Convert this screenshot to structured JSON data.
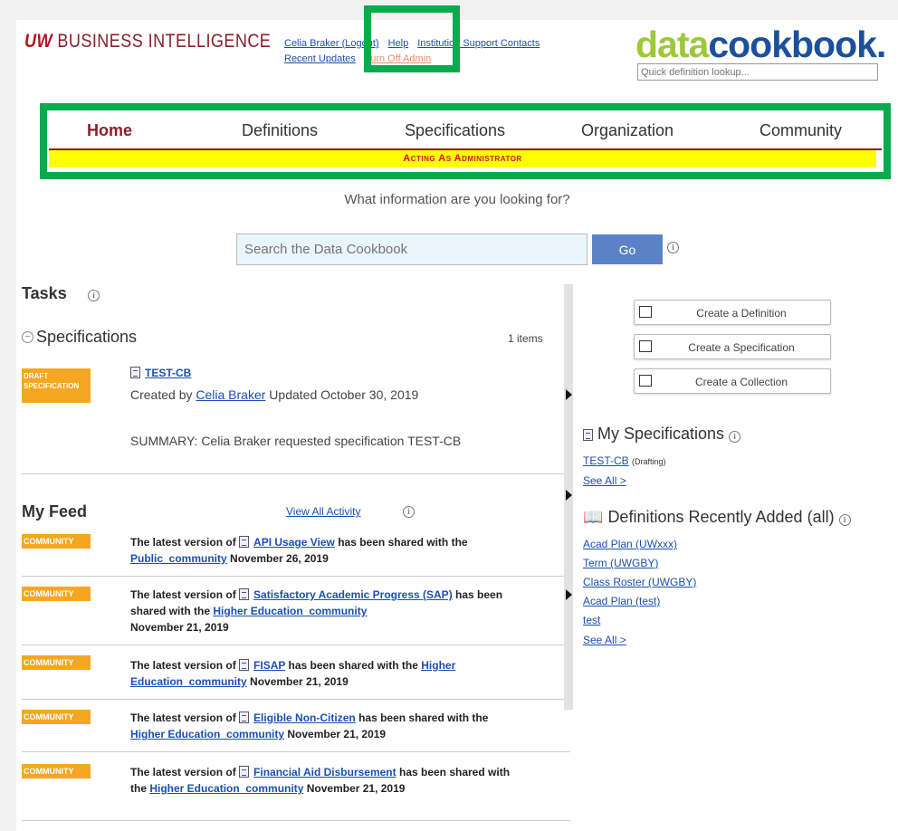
{
  "header": {
    "brand_uw": "UW",
    "brand_rest": "BUSINESS INTELLIGENCE",
    "user_link": "Celia Braker (Logout)",
    "help_link": "Help",
    "contacts_link": "Institution Support Contacts",
    "recent_updates": "Recent Updates",
    "turn_off_admin": "Turn Off Admin",
    "logo_data": "data",
    "logo_cookbook": "cookbook.",
    "quick_placeholder": "Quick definition lookup..."
  },
  "nav": {
    "items": [
      "Home",
      "Definitions",
      "Specifications",
      "Organization",
      "Community"
    ],
    "active": "Home",
    "admin_banner": "Acting As Administrator"
  },
  "search": {
    "question": "What information are you looking for?",
    "placeholder": "Search the Data Cookbook",
    "go_label": "Go"
  },
  "tasks": {
    "title": "Tasks",
    "spec_section": "Specifications",
    "count": "1 items",
    "item": {
      "badge": "DRAFT SPECIFICATION",
      "name": "TEST-CB",
      "created_by_prefix": "Created by",
      "created_by": "Celia Braker",
      "updated": "Updated October 30, 2019",
      "summary": "SUMMARY: Celia Braker requested specification TEST-CB"
    }
  },
  "feed": {
    "title": "My Feed",
    "view_all": "View All Activity",
    "items": [
      {
        "badge": "COMMUNITY",
        "prefix": "The latest version of",
        "link": "API Usage View",
        "mid": "has been shared with the",
        "community": "Public_community",
        "date": "November 26, 2019"
      },
      {
        "badge": "COMMUNITY",
        "prefix": "The latest version of",
        "link": "Satisfactory Academic Progress (SAP)",
        "mid": "has been shared with the",
        "community": "Higher Education_community",
        "date": "November 21, 2019"
      },
      {
        "badge": "COMMUNITY",
        "prefix": "The latest version of",
        "link": "FISAP",
        "mid": "has been shared with the",
        "community": "Higher Education_community",
        "date": "November 21, 2019"
      },
      {
        "badge": "COMMUNITY",
        "prefix": "The latest version of",
        "link": "Eligible Non-Citizen",
        "mid": "has been shared with the",
        "community": "Higher Education_community",
        "date": "November 21, 2019"
      },
      {
        "badge": "COMMUNITY",
        "prefix": "The latest version of",
        "link": "Financial Aid Disbursement",
        "mid": "has been shared with the",
        "community": "Higher Education_community",
        "date": "November 21, 2019"
      }
    ]
  },
  "actions": {
    "create_definition": "Create a Definition",
    "create_specification": "Create a Specification",
    "create_collection": "Create a Collection"
  },
  "my_specs": {
    "title": "My Specifications",
    "item": "TEST-CB",
    "status": "(Drafting)",
    "see_all": "See All >"
  },
  "recent_defs": {
    "title": "Definitions Recently Added (all)",
    "items": [
      "Acad Plan (UWxxx)",
      "Term (UWGBY)",
      "Class Roster (UWGBY)",
      "Acad Plan (test)",
      "test"
    ],
    "see_all": "See All >"
  },
  "colors": {
    "highlight": "#0aab4f",
    "brand": "#8b1e2b",
    "badge": "#f5a623",
    "admin_bar": "#ffff00"
  }
}
